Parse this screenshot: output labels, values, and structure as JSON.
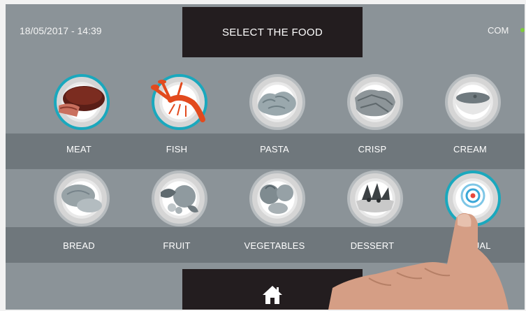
{
  "header": {
    "datetime": "18/05/2017 - 14:39",
    "title": "SELECT THE FOOD",
    "status": "COM"
  },
  "foods": [
    {
      "label": "MEAT",
      "icon": "meat-icon",
      "selected": true
    },
    {
      "label": "FISH",
      "icon": "lobster-icon",
      "selected": true
    },
    {
      "label": "PASTA",
      "icon": "pasta-icon",
      "selected": false
    },
    {
      "label": "CRISP",
      "icon": "crisp-icon",
      "selected": false
    },
    {
      "label": "CREAM",
      "icon": "cream-icon",
      "selected": false
    },
    {
      "label": "BREAD",
      "icon": "bread-icon",
      "selected": false
    },
    {
      "label": "FRUIT",
      "icon": "fruit-icon",
      "selected": false
    },
    {
      "label": "VEGETABLES",
      "icon": "vegetables-icon",
      "selected": false
    },
    {
      "label": "DESSERT",
      "icon": "dessert-icon",
      "selected": false
    },
    {
      "label": "NUAL",
      "icon": "manual-touch-icon",
      "selected": true
    }
  ],
  "footer": {
    "home_icon": "home-icon"
  },
  "colors": {
    "background": "#8b9398",
    "band": "#6f777c",
    "dark_panel": "#231d1f",
    "selected_ring": "#1aa8bd",
    "status_led": "#7ecb3a"
  }
}
